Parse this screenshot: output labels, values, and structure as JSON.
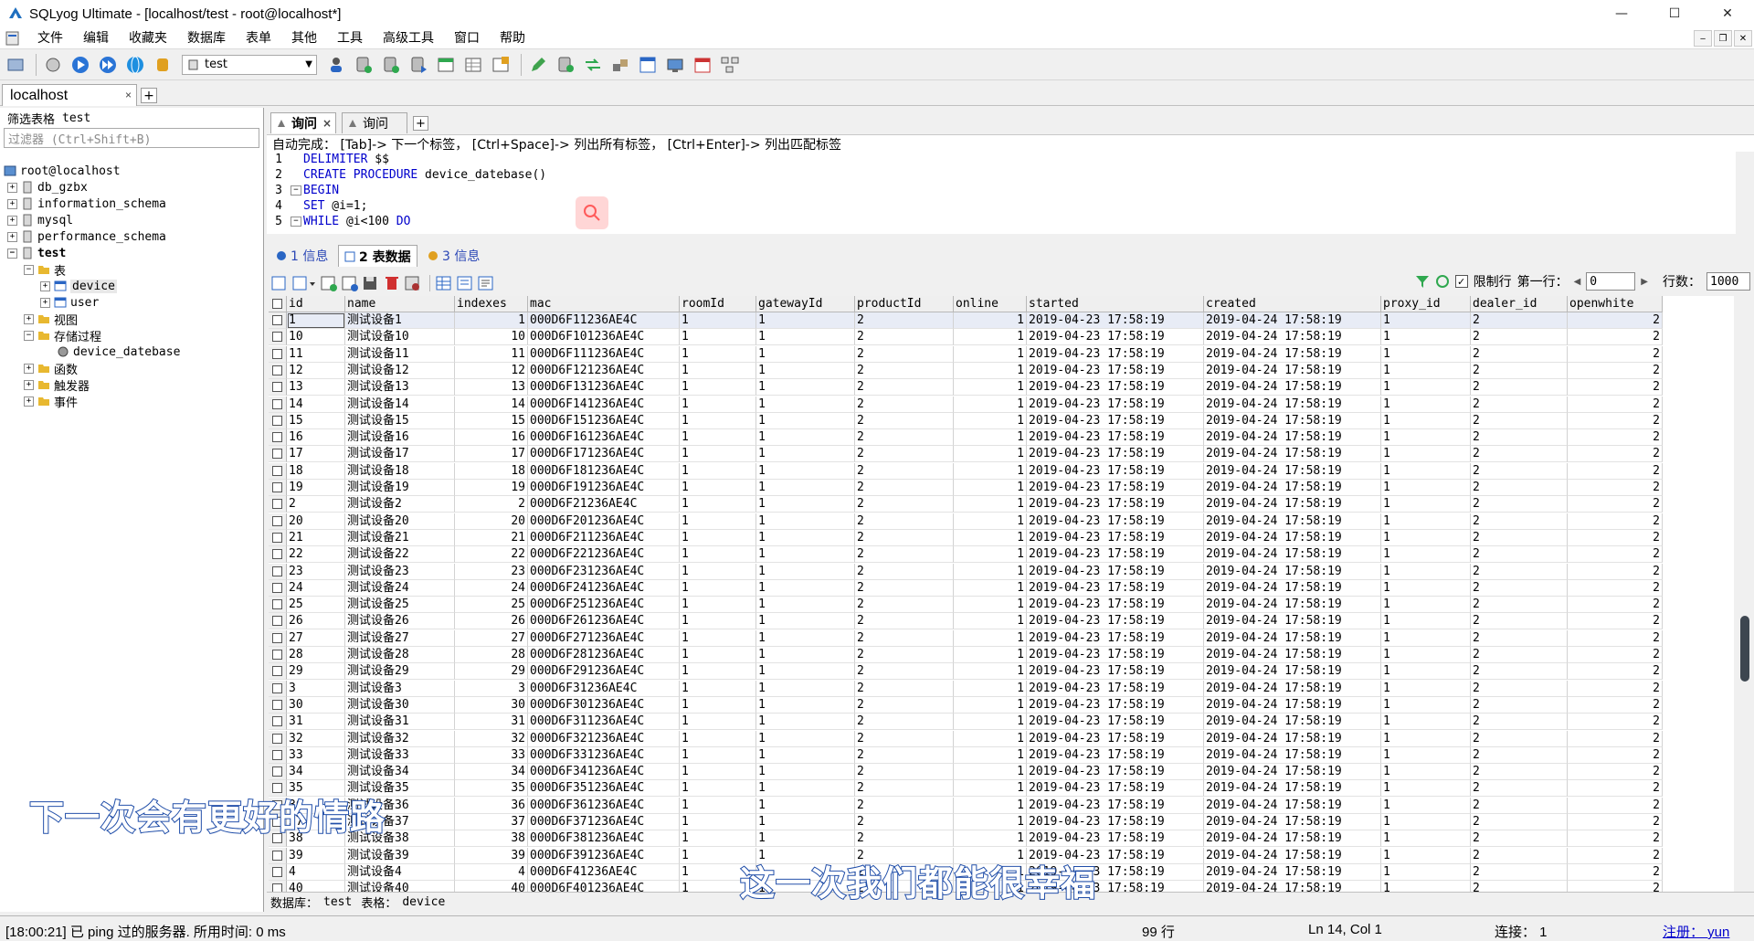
{
  "window": {
    "title": "SQLyog Ultimate - [localhost/test - root@localhost*]",
    "minimize": "—",
    "maximize": "☐",
    "close": "✕"
  },
  "menu": [
    "文件",
    "编辑",
    "收藏夹",
    "数据库",
    "表单",
    "其他",
    "工具",
    "高级工具",
    "窗口",
    "帮助"
  ],
  "toolbar": {
    "database_selected": "test"
  },
  "connection_tab": {
    "label": "localhost",
    "close": "×",
    "add": "+"
  },
  "filter": {
    "label": "筛选表格",
    "value": "test",
    "placeholder": "过滤器 (Ctrl+Shift+B)"
  },
  "tree": {
    "root": "root@localhost",
    "databases": [
      "db_gzbx",
      "information_schema",
      "mysql",
      "performance_schema",
      "test"
    ],
    "test_children": {
      "tables_label": "表",
      "tables": [
        "device",
        "user"
      ],
      "views_label": "视图",
      "procs_label": "存储过程",
      "procs": [
        "device_datebase"
      ],
      "funcs_label": "函数",
      "triggers_label": "触发器",
      "events_label": "事件"
    }
  },
  "query_tabs": [
    {
      "label": "询问",
      "active": true
    },
    {
      "label": "询问",
      "active": false
    }
  ],
  "autocomplete_hint": "自动完成： [Tab]-> 下一个标签， [Ctrl+Space]-> 列出所有标签， [Ctrl+Enter]-> 列出匹配标签",
  "editor_lines": [
    {
      "n": "1",
      "parts": [
        {
          "t": "DELIMITER",
          "k": true
        },
        {
          "t": " $$",
          "k": false
        }
      ]
    },
    {
      "n": "2",
      "parts": [
        {
          "t": "CREATE PROCEDURE",
          "k": true
        },
        {
          "t": " device_datebase()",
          "k": false
        }
      ]
    },
    {
      "n": "3",
      "fold": "−",
      "parts": [
        {
          "t": "BEGIN",
          "k": true
        }
      ]
    },
    {
      "n": "4",
      "parts": [
        {
          "t": "SET",
          "k": true
        },
        {
          "t": " @i=1;",
          "k": false
        }
      ]
    },
    {
      "n": "5",
      "fold": "−",
      "parts": [
        {
          "t": "WHILE",
          "k": true
        },
        {
          "t": " @i<100 ",
          "k": false
        },
        {
          "t": "DO",
          "k": true
        }
      ]
    }
  ],
  "result_tabs": [
    {
      "label": "1 信息",
      "active": false
    },
    {
      "label": "2 表数据",
      "active": true
    },
    {
      "label": "3 信息",
      "active": false
    }
  ],
  "grid_toolbar": {
    "limit_label": "限制行",
    "first_row_label": "第一行：",
    "first_row": "0",
    "rows_label": "行数：",
    "rows": "1000",
    "limit_checked": "✓"
  },
  "grid": {
    "columns": [
      "id",
      "name",
      "indexes",
      "mac",
      "roomId",
      "gatewayId",
      "productId",
      "online",
      "started",
      "created",
      "proxy_id",
      "dealer_id",
      "openwhite"
    ],
    "rows": [
      [
        "1",
        "测试设备1",
        "1",
        "000D6F11236AE4C",
        "1",
        "1",
        "2",
        "1",
        "2019-04-23 17:58:19",
        "2019-04-24 17:58:19",
        "1",
        "2",
        "2"
      ],
      [
        "10",
        "测试设备10",
        "10",
        "000D6F101236AE4C",
        "1",
        "1",
        "2",
        "1",
        "2019-04-23 17:58:19",
        "2019-04-24 17:58:19",
        "1",
        "2",
        "2"
      ],
      [
        "11",
        "测试设备11",
        "11",
        "000D6F111236AE4C",
        "1",
        "1",
        "2",
        "1",
        "2019-04-23 17:58:19",
        "2019-04-24 17:58:19",
        "1",
        "2",
        "2"
      ],
      [
        "12",
        "测试设备12",
        "12",
        "000D6F121236AE4C",
        "1",
        "1",
        "2",
        "1",
        "2019-04-23 17:58:19",
        "2019-04-24 17:58:19",
        "1",
        "2",
        "2"
      ],
      [
        "13",
        "测试设备13",
        "13",
        "000D6F131236AE4C",
        "1",
        "1",
        "2",
        "1",
        "2019-04-23 17:58:19",
        "2019-04-24 17:58:19",
        "1",
        "2",
        "2"
      ],
      [
        "14",
        "测试设备14",
        "14",
        "000D6F141236AE4C",
        "1",
        "1",
        "2",
        "1",
        "2019-04-23 17:58:19",
        "2019-04-24 17:58:19",
        "1",
        "2",
        "2"
      ],
      [
        "15",
        "测试设备15",
        "15",
        "000D6F151236AE4C",
        "1",
        "1",
        "2",
        "1",
        "2019-04-23 17:58:19",
        "2019-04-24 17:58:19",
        "1",
        "2",
        "2"
      ],
      [
        "16",
        "测试设备16",
        "16",
        "000D6F161236AE4C",
        "1",
        "1",
        "2",
        "1",
        "2019-04-23 17:58:19",
        "2019-04-24 17:58:19",
        "1",
        "2",
        "2"
      ],
      [
        "17",
        "测试设备17",
        "17",
        "000D6F171236AE4C",
        "1",
        "1",
        "2",
        "1",
        "2019-04-23 17:58:19",
        "2019-04-24 17:58:19",
        "1",
        "2",
        "2"
      ],
      [
        "18",
        "测试设备18",
        "18",
        "000D6F181236AE4C",
        "1",
        "1",
        "2",
        "1",
        "2019-04-23 17:58:19",
        "2019-04-24 17:58:19",
        "1",
        "2",
        "2"
      ],
      [
        "19",
        "测试设备19",
        "19",
        "000D6F191236AE4C",
        "1",
        "1",
        "2",
        "1",
        "2019-04-23 17:58:19",
        "2019-04-24 17:58:19",
        "1",
        "2",
        "2"
      ],
      [
        "2",
        "测试设备2",
        "2",
        "000D6F21236AE4C",
        "1",
        "1",
        "2",
        "1",
        "2019-04-23 17:58:19",
        "2019-04-24 17:58:19",
        "1",
        "2",
        "2"
      ],
      [
        "20",
        "测试设备20",
        "20",
        "000D6F201236AE4C",
        "1",
        "1",
        "2",
        "1",
        "2019-04-23 17:58:19",
        "2019-04-24 17:58:19",
        "1",
        "2",
        "2"
      ],
      [
        "21",
        "测试设备21",
        "21",
        "000D6F211236AE4C",
        "1",
        "1",
        "2",
        "1",
        "2019-04-23 17:58:19",
        "2019-04-24 17:58:19",
        "1",
        "2",
        "2"
      ],
      [
        "22",
        "测试设备22",
        "22",
        "000D6F221236AE4C",
        "1",
        "1",
        "2",
        "1",
        "2019-04-23 17:58:19",
        "2019-04-24 17:58:19",
        "1",
        "2",
        "2"
      ],
      [
        "23",
        "测试设备23",
        "23",
        "000D6F231236AE4C",
        "1",
        "1",
        "2",
        "1",
        "2019-04-23 17:58:19",
        "2019-04-24 17:58:19",
        "1",
        "2",
        "2"
      ],
      [
        "24",
        "测试设备24",
        "24",
        "000D6F241236AE4C",
        "1",
        "1",
        "2",
        "1",
        "2019-04-23 17:58:19",
        "2019-04-24 17:58:19",
        "1",
        "2",
        "2"
      ],
      [
        "25",
        "测试设备25",
        "25",
        "000D6F251236AE4C",
        "1",
        "1",
        "2",
        "1",
        "2019-04-23 17:58:19",
        "2019-04-24 17:58:19",
        "1",
        "2",
        "2"
      ],
      [
        "26",
        "测试设备26",
        "26",
        "000D6F261236AE4C",
        "1",
        "1",
        "2",
        "1",
        "2019-04-23 17:58:19",
        "2019-04-24 17:58:19",
        "1",
        "2",
        "2"
      ],
      [
        "27",
        "测试设备27",
        "27",
        "000D6F271236AE4C",
        "1",
        "1",
        "2",
        "1",
        "2019-04-23 17:58:19",
        "2019-04-24 17:58:19",
        "1",
        "2",
        "2"
      ],
      [
        "28",
        "测试设备28",
        "28",
        "000D6F281236AE4C",
        "1",
        "1",
        "2",
        "1",
        "2019-04-23 17:58:19",
        "2019-04-24 17:58:19",
        "1",
        "2",
        "2"
      ],
      [
        "29",
        "测试设备29",
        "29",
        "000D6F291236AE4C",
        "1",
        "1",
        "2",
        "1",
        "2019-04-23 17:58:19",
        "2019-04-24 17:58:19",
        "1",
        "2",
        "2"
      ],
      [
        "3",
        "测试设备3",
        "3",
        "000D6F31236AE4C",
        "1",
        "1",
        "2",
        "1",
        "2019-04-23 17:58:19",
        "2019-04-24 17:58:19",
        "1",
        "2",
        "2"
      ],
      [
        "30",
        "测试设备30",
        "30",
        "000D6F301236AE4C",
        "1",
        "1",
        "2",
        "1",
        "2019-04-23 17:58:19",
        "2019-04-24 17:58:19",
        "1",
        "2",
        "2"
      ],
      [
        "31",
        "测试设备31",
        "31",
        "000D6F311236AE4C",
        "1",
        "1",
        "2",
        "1",
        "2019-04-23 17:58:19",
        "2019-04-24 17:58:19",
        "1",
        "2",
        "2"
      ],
      [
        "32",
        "测试设备32",
        "32",
        "000D6F321236AE4C",
        "1",
        "1",
        "2",
        "1",
        "2019-04-23 17:58:19",
        "2019-04-24 17:58:19",
        "1",
        "2",
        "2"
      ],
      [
        "33",
        "测试设备33",
        "33",
        "000D6F331236AE4C",
        "1",
        "1",
        "2",
        "1",
        "2019-04-23 17:58:19",
        "2019-04-24 17:58:19",
        "1",
        "2",
        "2"
      ],
      [
        "34",
        "测试设备34",
        "34",
        "000D6F341236AE4C",
        "1",
        "1",
        "2",
        "1",
        "2019-04-23 17:58:19",
        "2019-04-24 17:58:19",
        "1",
        "2",
        "2"
      ],
      [
        "35",
        "测试设备35",
        "35",
        "000D6F351236AE4C",
        "1",
        "1",
        "2",
        "1",
        "2019-04-23 17:58:19",
        "2019-04-24 17:58:19",
        "1",
        "2",
        "2"
      ],
      [
        "36",
        "测试设备36",
        "36",
        "000D6F361236AE4C",
        "1",
        "1",
        "2",
        "1",
        "2019-04-23 17:58:19",
        "2019-04-24 17:58:19",
        "1",
        "2",
        "2"
      ],
      [
        "37",
        "测试设备37",
        "37",
        "000D6F371236AE4C",
        "1",
        "1",
        "2",
        "1",
        "2019-04-23 17:58:19",
        "2019-04-24 17:58:19",
        "1",
        "2",
        "2"
      ],
      [
        "38",
        "测试设备38",
        "38",
        "000D6F381236AE4C",
        "1",
        "1",
        "2",
        "1",
        "2019-04-23 17:58:19",
        "2019-04-24 17:58:19",
        "1",
        "2",
        "2"
      ],
      [
        "39",
        "测试设备39",
        "39",
        "000D6F391236AE4C",
        "1",
        "1",
        "2",
        "1",
        "2019-04-23 17:58:19",
        "2019-04-24 17:58:19",
        "1",
        "2",
        "2"
      ],
      [
        "4",
        "测试设备4",
        "4",
        "000D6F41236AE4C",
        "1",
        "1",
        "2",
        "1",
        "2019-04-23 17:58:19",
        "2019-04-24 17:58:19",
        "1",
        "2",
        "2"
      ],
      [
        "40",
        "测试设备40",
        "40",
        "000D6F401236AE4C",
        "1",
        "1",
        "2",
        "1",
        "2019-04-23 17:58:19",
        "2019-04-24 17:58:19",
        "1",
        "2",
        "2"
      ]
    ]
  },
  "db_info": {
    "db_label": "数据库：",
    "db": "test",
    "table_label": "表格：",
    "table": "device"
  },
  "status": {
    "message": "[18:00:21] 已 ping 过的服务器. 所用时间: 0 ms",
    "rows": "99 行",
    "position": "Ln 14, Col 1",
    "connections": "连接： 1",
    "register": "注册： yun"
  },
  "subtitles": {
    "line1": "下一次会有更好的情路",
    "line2": "这一次我们都能很幸福"
  },
  "colors": {
    "keyword": "#0000cc",
    "subtitle_stroke": "#1f4da8",
    "selection": "#e8ecf6"
  }
}
